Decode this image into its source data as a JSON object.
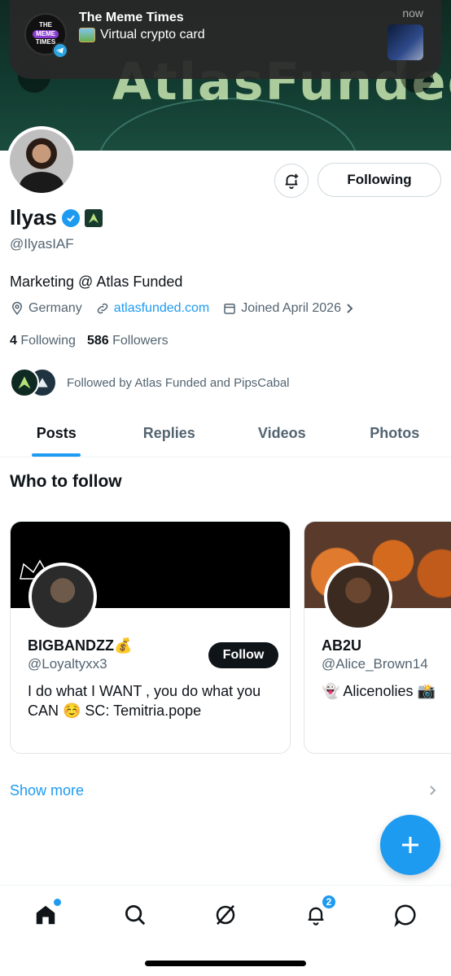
{
  "notification": {
    "app_title": "The Meme Times",
    "avatar_line1": "THE",
    "avatar_line2": "MEME",
    "avatar_line3": "TIMES",
    "body": "Virtual crypto card",
    "time": "now"
  },
  "banner": {
    "text": "AtlasFunded"
  },
  "profile": {
    "name": "Ilyas",
    "handle": "@IlyasIAF",
    "bio": "Marketing @ Atlas Funded",
    "location": "Germany",
    "website": "atlasfunded.com",
    "joined": "Joined April 2026",
    "following_count": "4",
    "following_label": "Following",
    "followers_count": "586",
    "followers_label": "Followers",
    "followed_by": "Followed by Atlas Funded and PipsCabal",
    "following_button": "Following"
  },
  "tabs": [
    {
      "label": "Posts",
      "active": true
    },
    {
      "label": "Replies",
      "active": false
    },
    {
      "label": "Videos",
      "active": false
    },
    {
      "label": "Photos",
      "active": false
    }
  ],
  "who_to_follow": {
    "title": "Who to follow",
    "cards": [
      {
        "name": "BIGBANDZZ💰",
        "handle": "@Loyaltyxx3",
        "bio": "I do what I WANT , you do what you CAN ☺️ SC: Temitria.pope",
        "button": "Follow"
      },
      {
        "name": "AB2U",
        "handle": "@Alice_Brown14",
        "bio": "👻 Alicenolies 📸"
      }
    ],
    "show_more": "Show more"
  },
  "bottom_nav": {
    "notifications_badge": "2"
  },
  "colors": {
    "accent": "#1d9bf0",
    "text": "#0f1419",
    "muted": "#536471"
  }
}
